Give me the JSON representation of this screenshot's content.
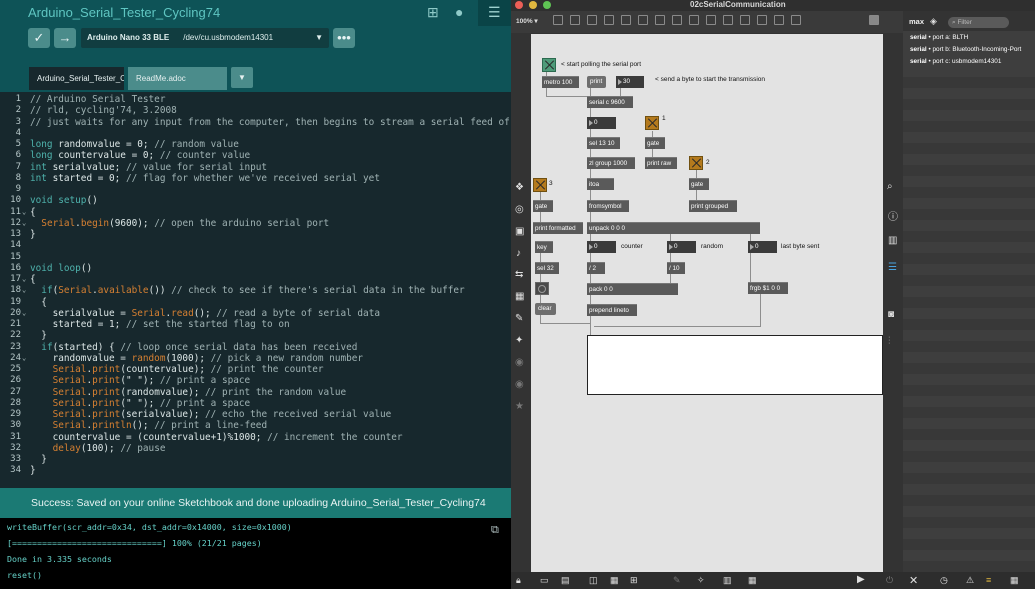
{
  "arduino": {
    "title": "Arduino_Serial_Tester_Cycling74",
    "board": "Arduino Nano 33 BLE",
    "port": "/dev/cu.usbmodem14301",
    "tabs": [
      "Arduino_Serial_Tester_C",
      "ReadMe.adoc"
    ],
    "icons": [
      "grid-icon",
      "account-icon",
      "more-vert-icon",
      "menu-icon"
    ],
    "code_lines": [
      "// Arduino Serial Tester",
      "// rld, cycling'74, 3.2008",
      "// just waits for any input from the computer, then begins to stream a serial feed of numbers back",
      "",
      "long randomvalue = 0; // random value",
      "long countervalue = 0; // counter value",
      "int serialvalue; // value for serial input",
      "int started = 0; // flag for whether we've received serial yet",
      "",
      "void setup()",
      "{",
      "  Serial.begin(9600); // open the arduino serial port",
      "}",
      "",
      "",
      "void loop()",
      "{",
      "  if(Serial.available()) // check to see if there's serial data in the buffer",
      "  {",
      "    serialvalue = Serial.read(); // read a byte of serial data",
      "    started = 1; // set the started flag to on",
      "  }",
      "  if(started) { // loop once serial data has been received",
      "    randomvalue = random(1000); // pick a new random number",
      "    Serial.print(countervalue); // print the counter",
      "    Serial.print(\" \"); // print a space",
      "    Serial.print(randomvalue); // print the random value",
      "    Serial.print(\" \"); // print a space",
      "    Serial.print(serialvalue); // echo the received serial value",
      "    Serial.println(); // print a line-feed",
      "    countervalue = (countervalue+1)%1000; // increment the counter",
      "    delay(100); // pause",
      "  }",
      "}"
    ],
    "status": "Success: Saved on your online Sketchbook and done uploading Arduino_Serial_Tester_Cycling74",
    "console_lines": [
      "writeBuffer(scr_addr=0x34, dst_addr=0x14000, size=0x1000)",
      "[==============================] 100% (21/21 pages)",
      "Done in 3.335 seconds",
      "reset()"
    ]
  },
  "max": {
    "window_title": "02cSerialCommunication",
    "zoom": "100%",
    "console_label": "max",
    "filter_placeholder": "Filter",
    "console_rows": [
      {
        "obj": "serial",
        "text": " • port a: BLTH"
      },
      {
        "obj": "serial",
        "text": " • port b: Bluetooth-Incoming-Port"
      },
      {
        "obj": "serial",
        "text": " • port c: usbmodem14301"
      }
    ],
    "patch": {
      "comments": {
        "poll": "< start polling the serial port",
        "send": "< send a byte to start the transmission",
        "counter": "counter",
        "random": "random",
        "lastbyte": "last byte sent",
        "toggle1": "1",
        "toggle2": "2",
        "toggle3": "3"
      },
      "objects": {
        "metro": "metro 100",
        "print_msg": "print",
        "num30": "30",
        "serial": "serial c 9600",
        "num0a": "0",
        "sel": "sel 13 10",
        "gate1": "gate",
        "zlgroup": "zl group 1000",
        "printraw": "print raw",
        "itoa": "itoa",
        "gate2": "gate",
        "gate3": "gate",
        "fromsymbol": "fromsymbol",
        "printgrouped": "print grouped",
        "printformatted": "print formatted",
        "unpack": "unpack 0 0 0",
        "key": "key",
        "num_counter": "0",
        "num_random": "0",
        "num_last": "0",
        "sel32": "sel 32",
        "div2": "/ 2",
        "div10": "/ 10",
        "pack": "pack 0 0",
        "frgb": "frgb $1 0 0",
        "clear": "clear",
        "prepend": "prepend lineto"
      }
    }
  }
}
